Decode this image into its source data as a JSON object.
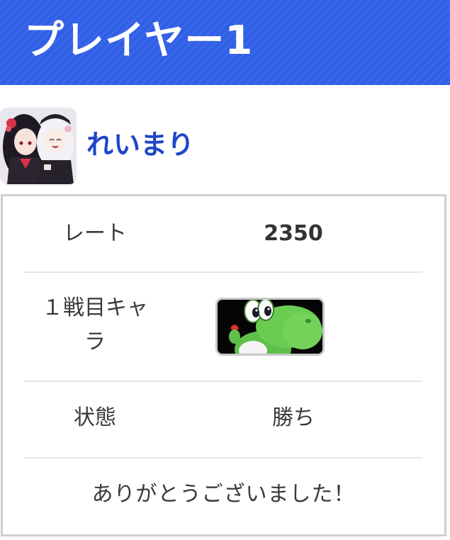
{
  "header": {
    "title": "プレイヤー1"
  },
  "profile": {
    "name": "れいまり",
    "avatar_icon": "user-avatar-illustration"
  },
  "stats": {
    "rate_label": "レート",
    "rate_value": "2350",
    "character_label_line1": "１戦目キャ",
    "character_label_line2": "ラ",
    "character_icon": "yoshi-character-icon",
    "status_label": "状態",
    "status_value": "勝ち"
  },
  "footer": {
    "message": "ありがとうございました！"
  },
  "colors": {
    "header_bg": "#2f5fe6",
    "name_color": "#1f45c9"
  }
}
